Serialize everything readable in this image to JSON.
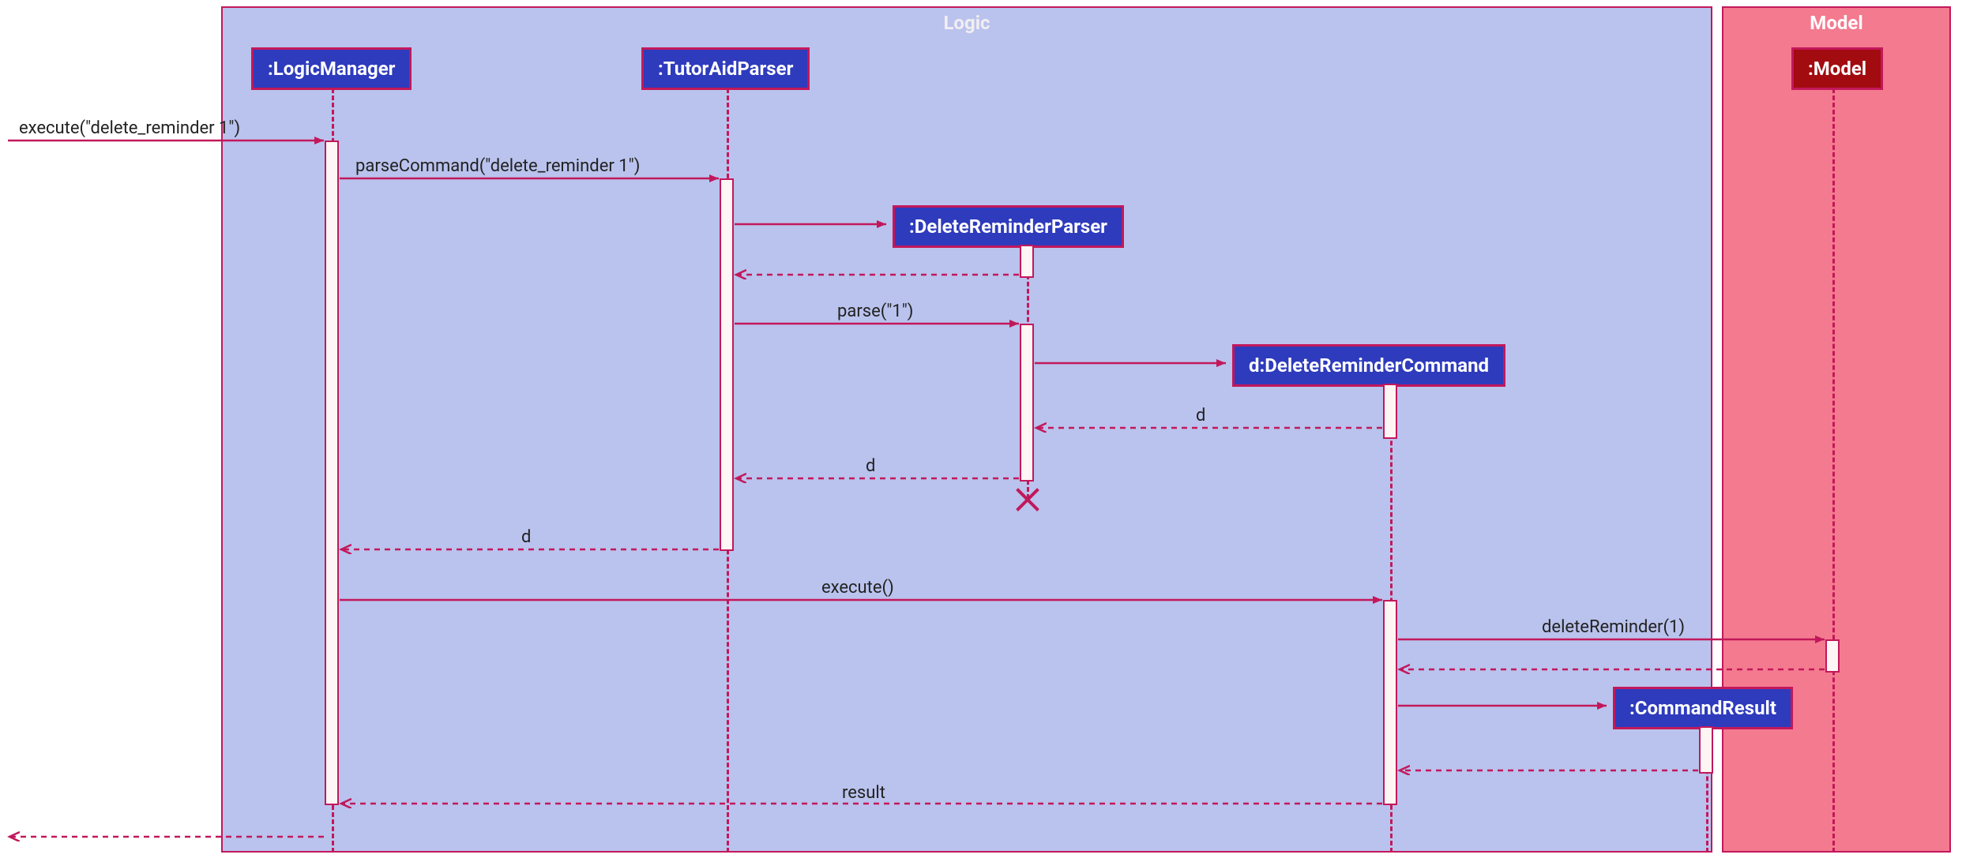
{
  "frames": {
    "logic": "Logic",
    "model": "Model"
  },
  "participants": {
    "logicManager": ":LogicManager",
    "tutorAidParser": ":TutorAidParser",
    "deleteReminderParser": ":DeleteReminderParser",
    "deleteReminderCommand": "d:DeleteReminderCommand",
    "commandResult": ":CommandResult",
    "model": ":Model"
  },
  "messages": {
    "m1": "execute(\"delete_reminder 1\")",
    "m2": "parseCommand(\"delete_reminder 1\")",
    "m3": "parse(\"1\")",
    "m4": "d",
    "m5": "d",
    "m6": "d",
    "m7": "execute()",
    "m8": "deleteReminder(1)",
    "m9": "result"
  },
  "colors": {
    "participantBg": "#2e3bbd",
    "modelBg": "#a20b0f",
    "frameBorder": "#c2185b",
    "logicFrameBg": "#bac3ed",
    "modelFrameBg": "#f47a8f"
  }
}
